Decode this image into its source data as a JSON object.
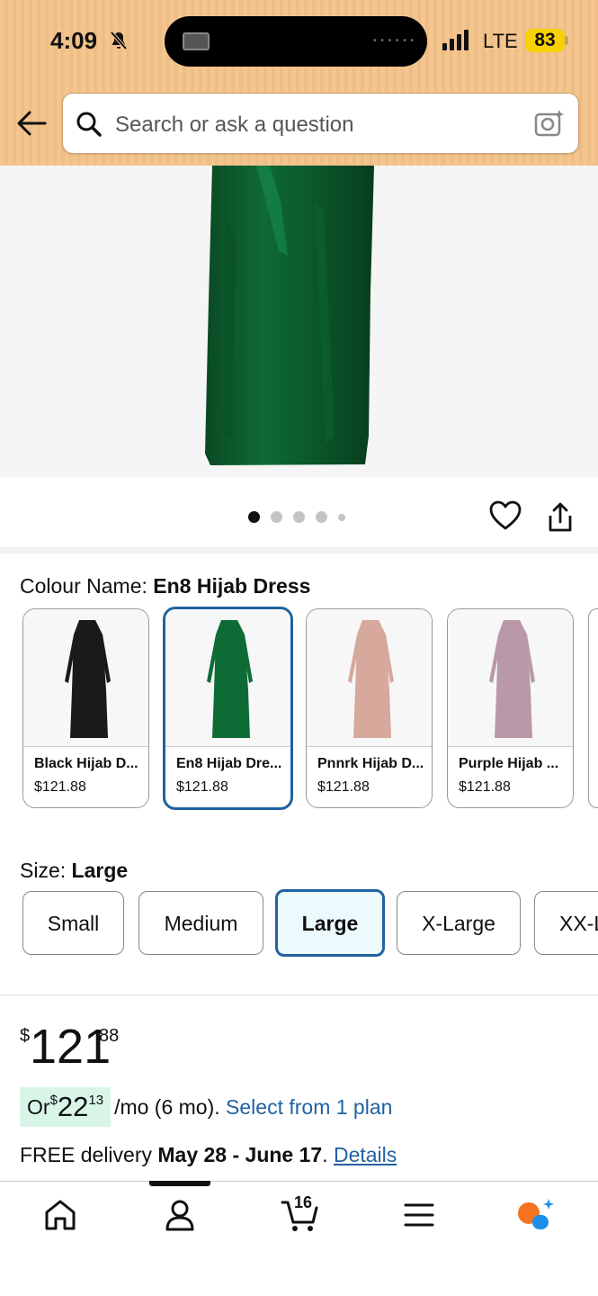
{
  "status_bar": {
    "time": "4:09",
    "network": "LTE",
    "battery": "83"
  },
  "search": {
    "placeholder": "Search or ask a question"
  },
  "product": {
    "colour_label": "Colour Name: ",
    "colour_value": "En8 Hijab Dress",
    "image_count": 5,
    "active_image_index": 0
  },
  "colours": [
    {
      "name": "Black Hijab D...",
      "price": "$121.88",
      "color": "#1a1a1a",
      "selected": false
    },
    {
      "name": "En8 Hijab Dre...",
      "price": "$121.88",
      "color": "#0e6b36",
      "selected": true
    },
    {
      "name": "Pnnrk Hijab D...",
      "price": "$121.88",
      "color": "#d7a89c",
      "selected": false
    },
    {
      "name": "Purple Hijab ...",
      "price": "$121.88",
      "color": "#b999a8",
      "selected": false
    }
  ],
  "size": {
    "label": "Size: ",
    "value": "Large",
    "options": [
      "Small",
      "Medium",
      "Large",
      "X-Large",
      "XX-L"
    ]
  },
  "price": {
    "symbol": "$",
    "whole": "121",
    "fraction": "88"
  },
  "monthly": {
    "prefix": "Or ",
    "symbol": "$",
    "whole": "22",
    "fraction": "13",
    "suffix": "/mo (6 mo). ",
    "link": "Select from 1 plan"
  },
  "delivery": {
    "prefix": "FREE delivery ",
    "dates": "May 28 - June 17",
    "separator": ". ",
    "link": "Details"
  },
  "bottom_nav": {
    "cart_count": "16"
  },
  "colors": {
    "accent_blue": "#2162a1",
    "header_bg": "#f3c58f",
    "emi_chip_bg": "#d8f5e8"
  }
}
